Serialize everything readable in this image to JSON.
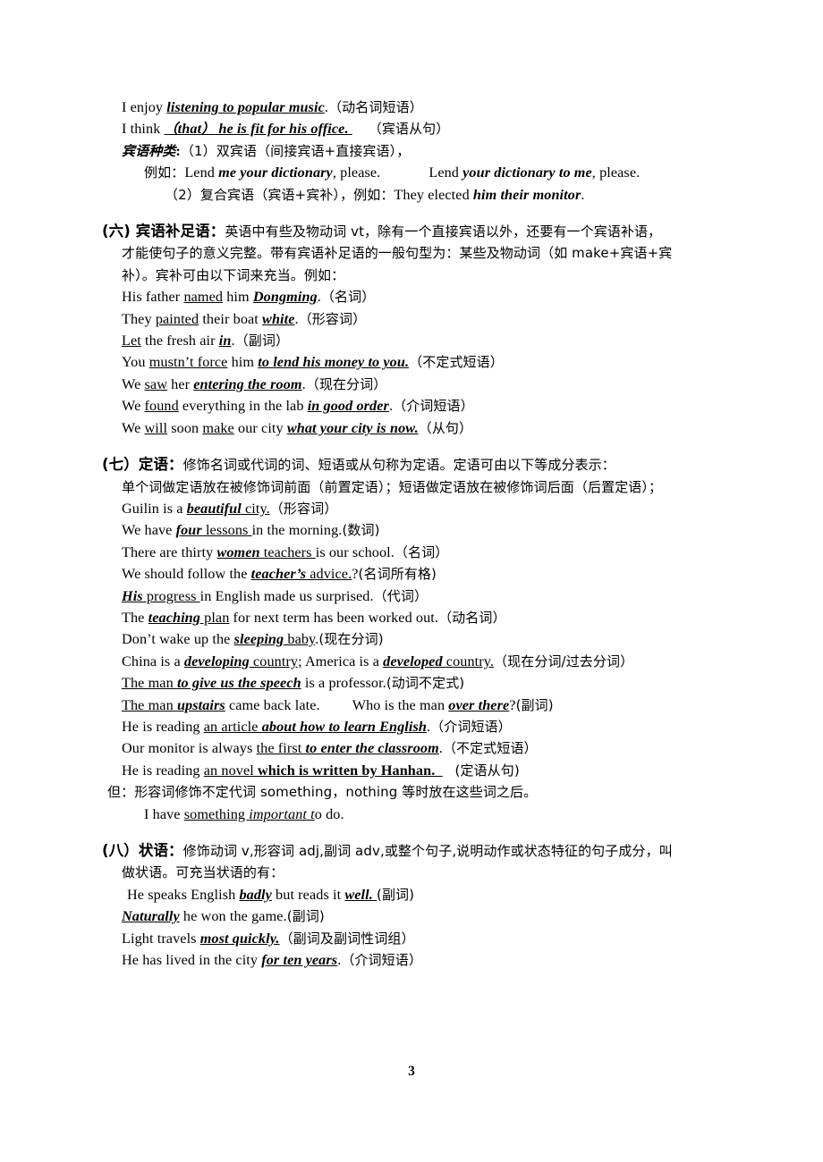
{
  "document": {
    "page_number": "3",
    "language": "zh-CN / en"
  },
  "top_block": {
    "line1": {
      "pre": "I enjoy ",
      "emph": "listening to popular music",
      "post": ".",
      "note": "（动名词短语）"
    },
    "line2": {
      "pre": "I think ",
      "lp": "（",
      "emph1": "that",
      "rp": "）",
      "emph2": " he is fit for his office. ",
      "note": "（宾语从句）"
    },
    "line3": {
      "label": "宾语种类",
      "colon": ":",
      "text": "（1）双宾语（间接宾语+直接宾语），"
    },
    "line4": {
      "label": "例如：",
      "s1_pre": "Lend ",
      "s1_emph": "me your dictionary",
      "s1_post": ", please.",
      "s2_pre": "Lend ",
      "s2_emph": "your dictionary to me",
      "s2_post": ", please."
    },
    "line5": {
      "text": "（2）复合宾语（宾语+宾补），例如：",
      "s_pre": "They elected ",
      "s_emph": "him their monitor",
      "s_post": "."
    }
  },
  "section_six": {
    "heading": "(六) 宾语补足语：",
    "body_line1": "英语中有些及物动词 vt，除有一个直接宾语以外，还要有一个宾语补语，",
    "body_line2": "才能使句子的意义完整。带有宾语补足语的一般句型为：某些及物动词（如 make+宾语+宾",
    "body_line3": "补）。宾补可由以下词来充当。例如：",
    "examples": [
      {
        "p1": "His father ",
        "u1": "named",
        "p2": " him ",
        "e1": "Dongming",
        "p3": ".",
        "note": "（名词）"
      },
      {
        "p1": "They ",
        "u1": "painted",
        "p2": " their boat ",
        "e1": "white",
        "p3": ".",
        "note": "（形容词）"
      },
      {
        "p1": "",
        "u1": "Let",
        "p2": " the fresh air ",
        "e1": "in",
        "p3": ".",
        "note": "（副词）"
      },
      {
        "p1": "You ",
        "u1": "mustn’t force",
        "p2": " him ",
        "e1": "to lend his money to you.",
        "p3": "",
        "note": "（不定式短语）"
      },
      {
        "p1": "We ",
        "u1": "saw",
        "p2": " her ",
        "e1": "entering the room",
        "p3": ".",
        "note": "（现在分词）"
      },
      {
        "p1": "We ",
        "u1": "found",
        "p2": " everything in the lab ",
        "e1": "in good order",
        "p3": ".",
        "note": "（介词短语）"
      },
      {
        "p1": "We ",
        "u1": "will",
        "p2": " soon ",
        "u2": "make",
        "p2b": " our city ",
        "e1": "what your city is now.",
        "p3": "",
        "note": "（从句）"
      }
    ]
  },
  "section_seven": {
    "heading": "(七）定语：",
    "body_line1": "修饰名词或代词的词、短语或从句称为定语。定语可由以下等成分表示：",
    "body_line2": "单个词做定语放在被修饰词前面（前置定语）；短语做定语放在被修饰词后面（后置定语）；",
    "examples": [
      {
        "p1": "Guilin is a ",
        "e1": "beautiful",
        "u1": " city.",
        "p3": "",
        "note": "（形容词）"
      },
      {
        "p1": "We have ",
        "e1": "four",
        "u1": " lessons ",
        "p3": "in the morning.",
        "note": "(数词)"
      },
      {
        "p1": "There are thirty ",
        "e1": "women",
        "u1": " teachers ",
        "p3": "is our school.",
        "note": "（名词）"
      },
      {
        "p1": "We should follow the ",
        "e1": "teacher’s",
        "u1": " advice.",
        "p3": "?",
        "note": "(名词所有格)"
      },
      {
        "p1": "",
        "e1": "His",
        "u1": " progress ",
        "p3": "in English made us surprised.",
        "note": "（代词）"
      },
      {
        "p1": "The ",
        "e1": "teaching",
        "u1": " plan",
        "p3": " for next term has been worked out.",
        "note": "（动名词）"
      },
      {
        "p1": "Don’t wake up the ",
        "e1": "sleeping",
        "u1": " baby",
        "p3": ".",
        "note": "(现在分词)"
      }
    ],
    "line_china": {
      "p1": "China is a ",
      "e1": "developing",
      "u1": " country;",
      "p2": " America is a ",
      "e2": "developed",
      "u2": " country.",
      "note": "（现在分词/过去分词）"
    },
    "line_speech": {
      "u1": "The man ",
      "e1": "to give us the speech",
      "p2": " is a professor.",
      "note": "(动词不定式)"
    },
    "line_upstairs": {
      "u1": "The man ",
      "e1": "upstairs",
      "p2": " came back late.",
      "p3": "Who is the man ",
      "e2": "over there",
      "p4": "?",
      "note": "(副词)"
    },
    "line_article": {
      "p1": "He is reading ",
      "u1": "an article ",
      "e1": "about how to learn English",
      "p2": ".",
      "note": "（介词短语）"
    },
    "line_monitor": {
      "p1": "Our monitor is always ",
      "u1": "the first ",
      "e1": "to enter the classroom",
      "p2": ".",
      "note": "（不定式短语）"
    },
    "line_novel": {
      "p1": "He is reading ",
      "u1": "an novel ",
      "e1": "which is written by Hanhan. ",
      "p2": "",
      "note": "(定语从句)"
    },
    "note_line": "但：形容词修饰不定代词 something，nothing 等时放在这些词之后。",
    "note_example": {
      "p1": "I have ",
      "u1": "something ",
      "e1": "important t",
      "p2": "o do."
    }
  },
  "section_eight": {
    "heading": "(八）状语：",
    "body_line1": "修饰动词 v,形容词 adj,副词 adv,或整个句子,说明动作或状态特征的句子成分，叫",
    "body_line2": "做状语。可充当状语的有：",
    "examples": [
      {
        "p1": "He speaks English ",
        "e1": "badly",
        "p2": " but reads it ",
        "e2": "well. ",
        "p3": "",
        "note": "(副词)"
      },
      {
        "p1": "",
        "e1": "Naturally",
        "p2": " he won the game.",
        "p3": "",
        "note": "(副词)"
      },
      {
        "p1": "Light travels ",
        "e1": "most quickly.",
        "p2": "",
        "p3": "",
        "note": "（副词及副词性词组）"
      },
      {
        "p1": "He has lived in the city ",
        "e1": "for ten years",
        "p2": ".",
        "p3": "",
        "note": "（介词短语）"
      }
    ]
  }
}
